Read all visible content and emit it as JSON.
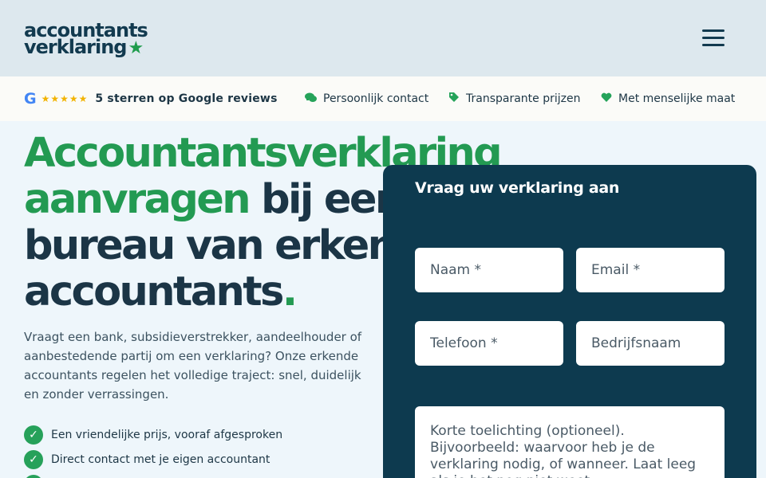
{
  "header": {
    "logo_line1": "accountants",
    "logo_line2": "verklaring",
    "logo_star": "★",
    "menu_icon": "hamburger-menu-icon"
  },
  "trustbar": {
    "google_icon": "G",
    "stars": "★★★★★",
    "google_text": "5 sterren op Google reviews",
    "items": [
      {
        "icon": "chat-icon",
        "glyph": "💬",
        "label": "Persoonlijk contact"
      },
      {
        "icon": "tag-icon",
        "glyph": "🏷",
        "label": "Transparante prijzen"
      },
      {
        "icon": "heart-icon",
        "glyph": "♥",
        "label": "Met menselijke maat"
      }
    ]
  },
  "hero": {
    "title_green": "Accountantsverklaring",
    "title_green2": "aanvragen",
    "title_dark1": " bij een",
    "title_dark2": "bureau van erkende",
    "title_dark3": "accountants",
    "title_dot": ".",
    "intro": "Vraagt een bank, subsidieverstrekker, aandeelhouder of aanbestedende partij om een verklaring? Onze erkende accountants regelen het volledige traject: snel, duidelijk en zonder verrassingen.",
    "checks": [
      "Een vriendelijke prijs, vooraf afgesproken",
      "Direct contact met je eigen accountant",
      ""
    ]
  },
  "form": {
    "title": "Vraag uw verklaring aan",
    "name_placeholder": "Naam *",
    "email_placeholder": "Email *",
    "phone_placeholder": "Telefoon *",
    "company_placeholder": "Bedrijfsnaam",
    "message_placeholder": "Korte toelichting (optioneel). Bijvoorbeeld: waarvoor heb je de verklaring nodig, of wanneer. Laat leeg als je het nog niet weet."
  },
  "colors": {
    "brand_green": "#239a52",
    "brand_navy": "#0d3a4f",
    "header_bg": "#dde8ee",
    "page_bg": "#eef6fb"
  }
}
